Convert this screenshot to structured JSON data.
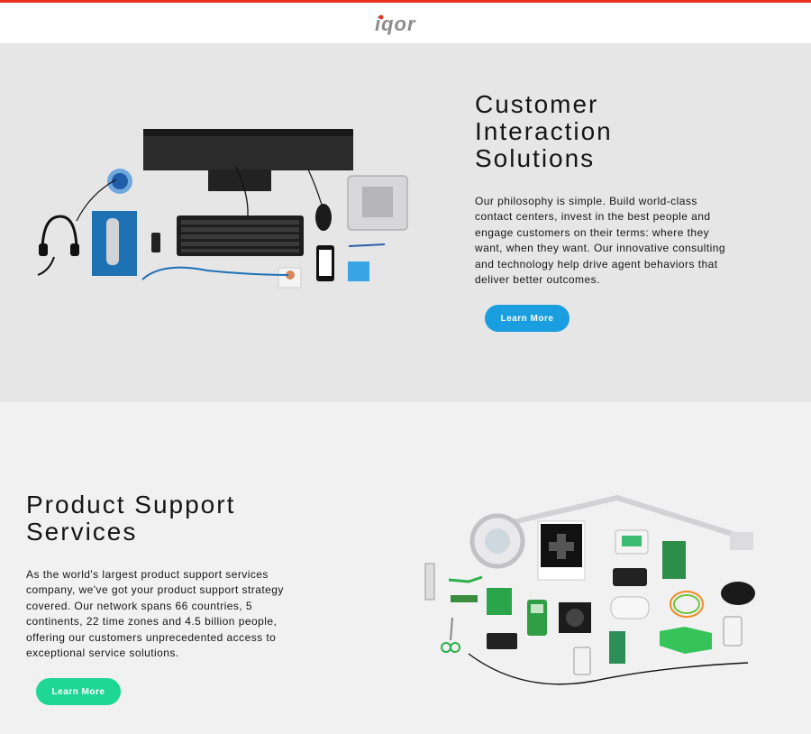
{
  "header": {
    "logo_text": "iqor"
  },
  "sections": [
    {
      "title_lines": [
        "Customer",
        "Interaction",
        "Solutions"
      ],
      "body_lines": [
        "Our philosophy is simple. Build world-class",
        "contact centers, invest in the best people and",
        "engage customers on their terms: where they",
        "want, when they want. Our innovative consulting",
        "and technology help drive agent behaviors that",
        "deliver better outcomes."
      ],
      "button_label": "Learn More"
    },
    {
      "title_lines": [
        "Product Support",
        "Services"
      ],
      "body_lines": [
        "As the world's largest product support services",
        "company, we've got your product support strategy",
        "covered. Our network spans 66 countries, 5",
        "continents, 22 time zones and 4.5 billion people,",
        "offering our customers unprecedented access to",
        "exceptional service solutions."
      ],
      "button_label": "Learn More"
    }
  ],
  "colors": {
    "top_accent": "#e8321f",
    "button_blue": "#1b9ee0",
    "button_green": "#1fd795"
  }
}
